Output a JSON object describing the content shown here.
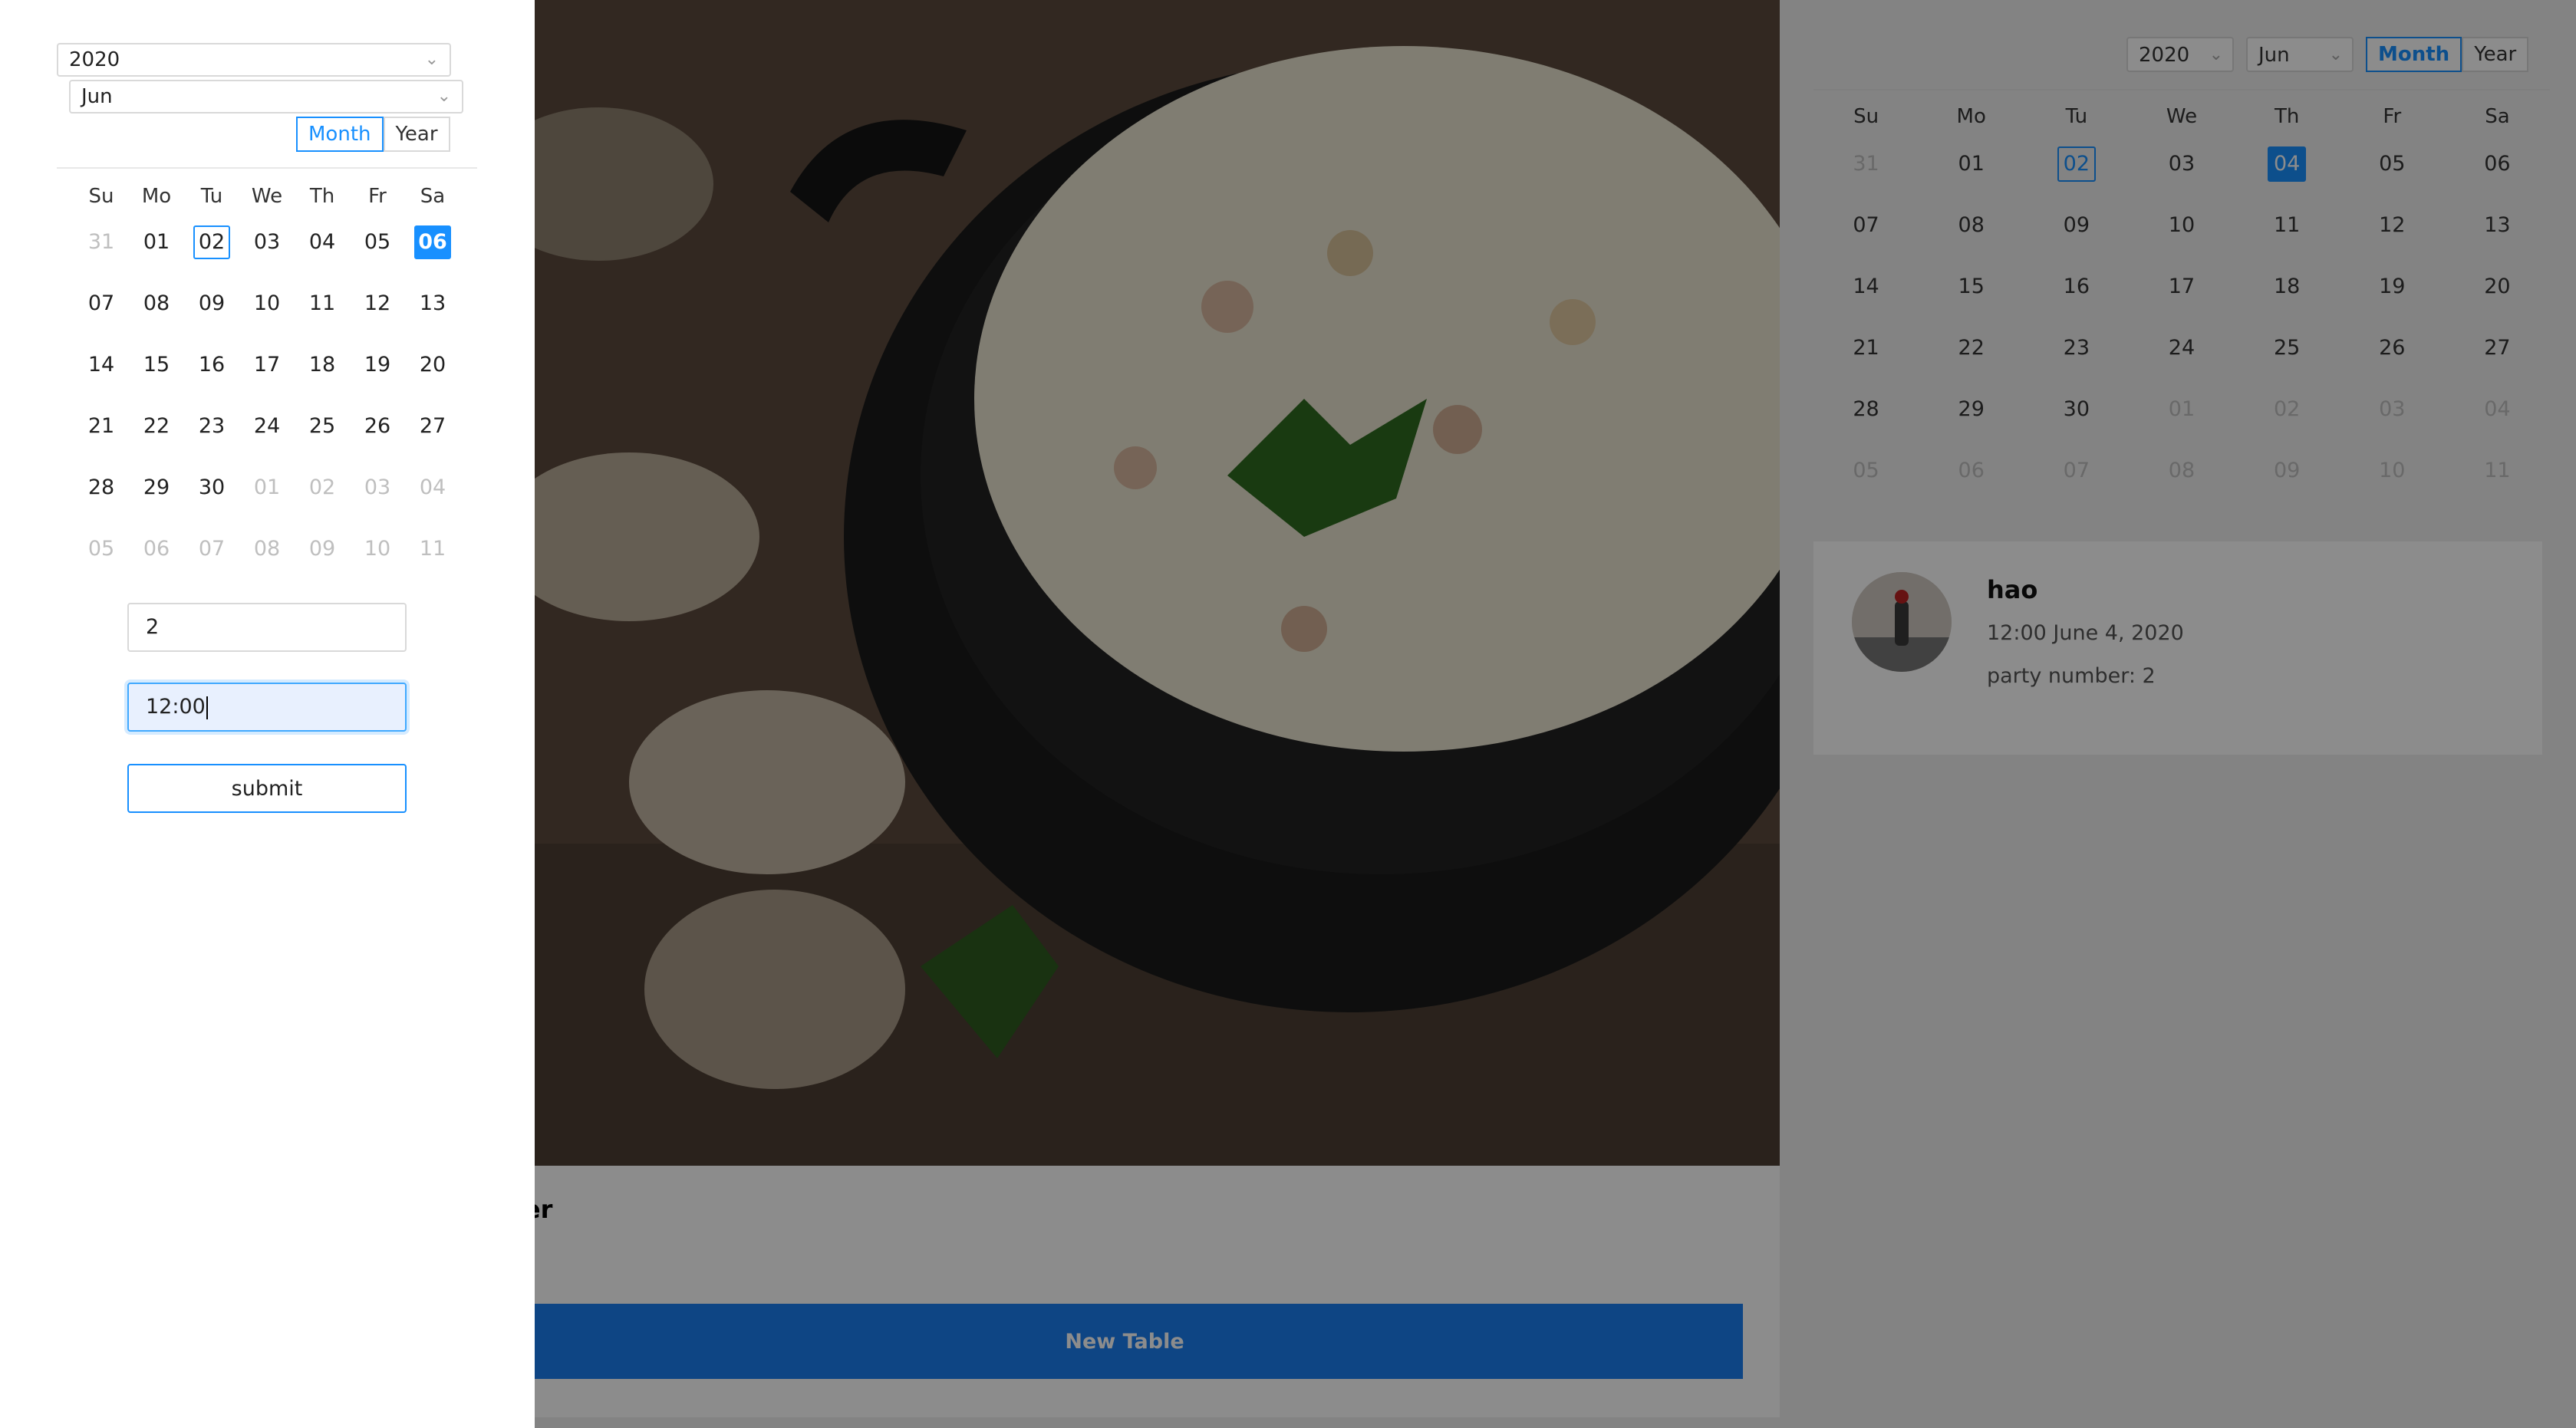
{
  "background": {
    "card": {
      "title_partial": "der",
      "new_table_label": "New Table"
    },
    "calendar": {
      "year": "2020",
      "month": "Jun",
      "mode_month": "Month",
      "mode_year": "Year",
      "weekdays": [
        "Su",
        "Mo",
        "Tu",
        "We",
        "Th",
        "Fr",
        "Sa"
      ],
      "weeks": [
        [
          "31",
          "01",
          "02",
          "03",
          "04",
          "05",
          "06"
        ],
        [
          "07",
          "08",
          "09",
          "10",
          "11",
          "12",
          "13"
        ],
        [
          "14",
          "15",
          "16",
          "17",
          "18",
          "19",
          "20"
        ],
        [
          "21",
          "22",
          "23",
          "24",
          "25",
          "26",
          "27"
        ],
        [
          "28",
          "29",
          "30",
          "01",
          "02",
          "03",
          "04"
        ],
        [
          "05",
          "06",
          "07",
          "08",
          "09",
          "10",
          "11"
        ]
      ],
      "today": "02",
      "selected": "04"
    },
    "booking": {
      "name": "hao",
      "time": "12:00 June 4, 2020",
      "party": "party number: 2"
    }
  },
  "drawer": {
    "year": "2020",
    "month": "Jun",
    "mode_month": "Month",
    "mode_year": "Year",
    "weekdays": [
      "Su",
      "Mo",
      "Tu",
      "We",
      "Th",
      "Fr",
      "Sa"
    ],
    "weeks": [
      [
        "31",
        "01",
        "02",
        "03",
        "04",
        "05",
        "06"
      ],
      [
        "07",
        "08",
        "09",
        "10",
        "11",
        "12",
        "13"
      ],
      [
        "14",
        "15",
        "16",
        "17",
        "18",
        "19",
        "20"
      ],
      [
        "21",
        "22",
        "23",
        "24",
        "25",
        "26",
        "27"
      ],
      [
        "28",
        "29",
        "30",
        "01",
        "02",
        "03",
        "04"
      ],
      [
        "05",
        "06",
        "07",
        "08",
        "09",
        "10",
        "11"
      ]
    ],
    "today": "02",
    "selected": "06",
    "party_value": "2",
    "time_value": "12:00",
    "submit_label": "submit"
  },
  "colors": {
    "accent": "#1890ff",
    "primary_button": "#1a7ef0",
    "overlay": "rgba(0,0,0,0.45)"
  }
}
